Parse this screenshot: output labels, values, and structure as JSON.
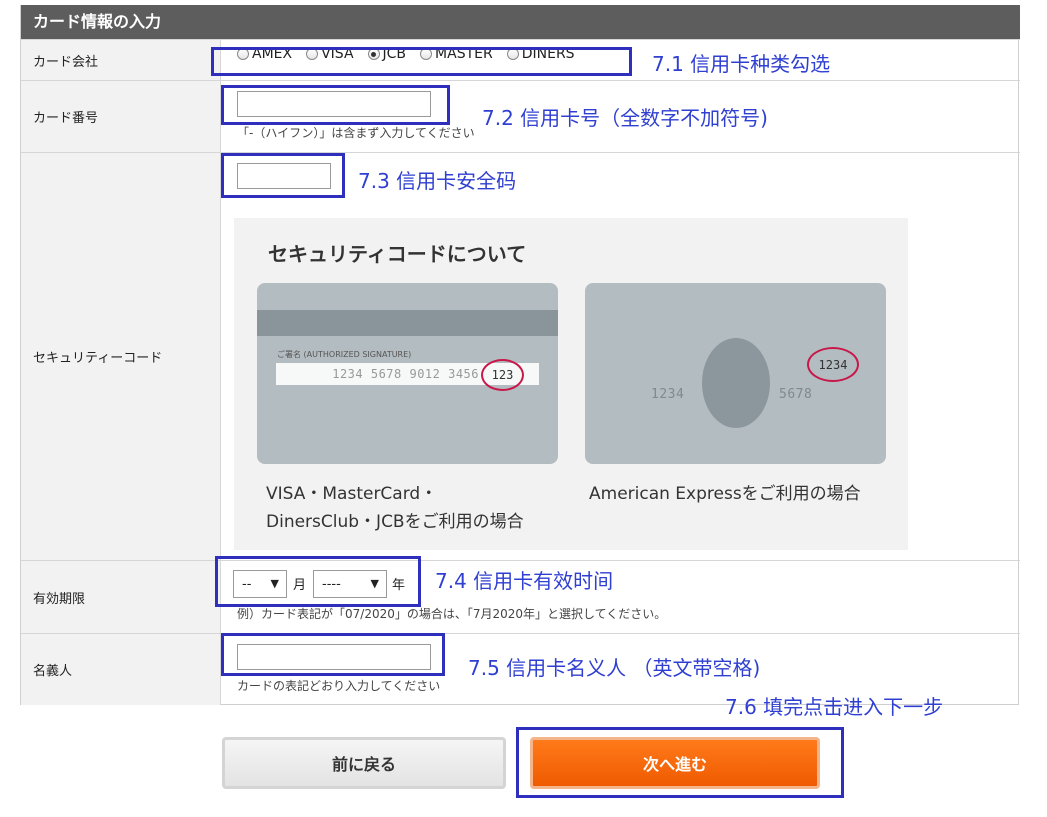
{
  "form": {
    "header": "カード情報の入力",
    "rows": {
      "company": {
        "label": "カード会社"
      },
      "number": {
        "label": "カード番号",
        "value": "",
        "note": "「-（ハイフン）」は含まず入力してください"
      },
      "security": {
        "label": "セキュリティーコード",
        "value": ""
      },
      "expiry": {
        "label": "有効期限",
        "month_value": "--",
        "month_unit": "月",
        "year_value": "----",
        "year_unit": "年",
        "note": "例）カード表記が「07/2020」の場合は、「7月2020年」と選択してください。"
      },
      "holder": {
        "label": "名義人",
        "value": "",
        "note": "カードの表記どおり入力してください"
      }
    },
    "card_brands": [
      "AMEX",
      "VISA",
      "JCB",
      "MASTER",
      "DINERS"
    ],
    "selected_brand": "JCB"
  },
  "security_info": {
    "title": "セキュリティコードについて",
    "card_back": {
      "sig_label": "ご署名 (AUTHORIZED SIGNATURE)",
      "number": "1234 5678 9012 3456",
      "cvv": "123",
      "caption_line1": "VISA・MasterCard・",
      "caption_line2": "DinersClub・JCBをご利用の場合"
    },
    "card_amex": {
      "cvv": "1234",
      "num_left": "1234",
      "num_right": "5678",
      "caption": "American Expressをご利用の場合"
    }
  },
  "buttons": {
    "back": "前に戻る",
    "next": "次へ進む"
  },
  "annotations": {
    "a1": "7.1 信用卡种类勾选",
    "a2": "7.2 信用卡号（全数字不加符号)",
    "a3": "7.3 信用卡安全码",
    "a4": "7.4 信用卡有效时间",
    "a5": "7.5 信用卡名义人 （英文带空格)",
    "a6": "7.6 填完点击进入下一步"
  },
  "colors": {
    "header_bg": "#5d5d5d",
    "annotation": "#2f3fd1",
    "next_button": "#ef5a00",
    "cvv_circle": "#c8184a"
  }
}
